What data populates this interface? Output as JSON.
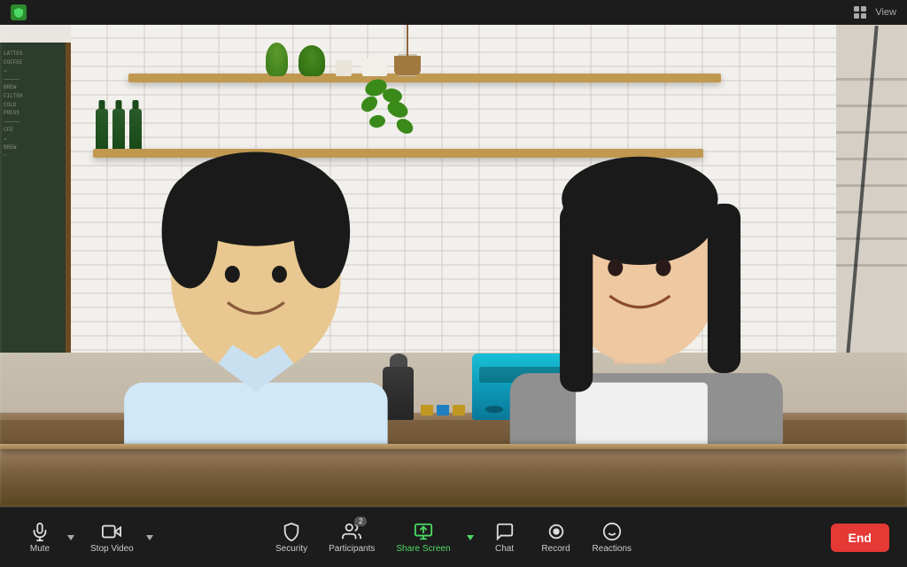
{
  "titlebar": {
    "shield_label": "✓",
    "view_label": "View",
    "grid_label": "⊞"
  },
  "video": {
    "scene_description": "Two people in a cafe setting",
    "person1_name": "",
    "person2_name": ""
  },
  "toolbar": {
    "mute_label": "Mute",
    "stop_video_label": "Stop Video",
    "security_label": "Security",
    "participants_label": "Participants",
    "participants_count": "2",
    "share_screen_label": "Share Screen",
    "chat_label": "Chat",
    "record_label": "Record",
    "reactions_label": "Reactions",
    "end_label": "End",
    "caret": "^"
  },
  "icons": {
    "mic": "🎤",
    "camera": "📹",
    "shield": "🛡",
    "people": "👥",
    "share": "⬆",
    "chat_bubble": "💬",
    "record_dot": "⏺",
    "emoji": "😊",
    "shield_green": "🛡"
  }
}
